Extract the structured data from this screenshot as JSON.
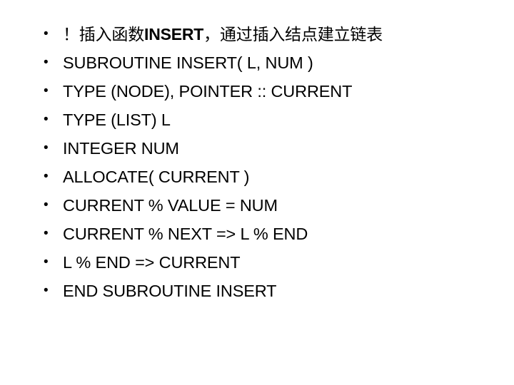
{
  "slide": {
    "background_color": "#ffffff",
    "text_color": "#000000",
    "bullet_glyph": "•",
    "bullets": [
      {
        "text": "！插入函数INSERT，通过插入结点建立链表",
        "script": "cjk"
      },
      {
        "text": "SUBROUTINE INSERT( L, NUM )",
        "script": "latin"
      },
      {
        "text": "TYPE (NODE), POINTER :: CURRENT",
        "script": "latin"
      },
      {
        "text": "TYPE (LIST) L",
        "script": "latin"
      },
      {
        "text": "INTEGER NUM",
        "script": "latin"
      },
      {
        "text": "ALLOCATE( CURRENT )",
        "script": "latin"
      },
      {
        "text": "CURRENT % VALUE = NUM",
        "script": "latin"
      },
      {
        "text": "CURRENT % NEXT => L % END",
        "script": "latin"
      },
      {
        "text": "L % END => CURRENT",
        "script": "latin"
      },
      {
        "text": "END SUBROUTINE INSERT",
        "script": "latin"
      }
    ]
  }
}
